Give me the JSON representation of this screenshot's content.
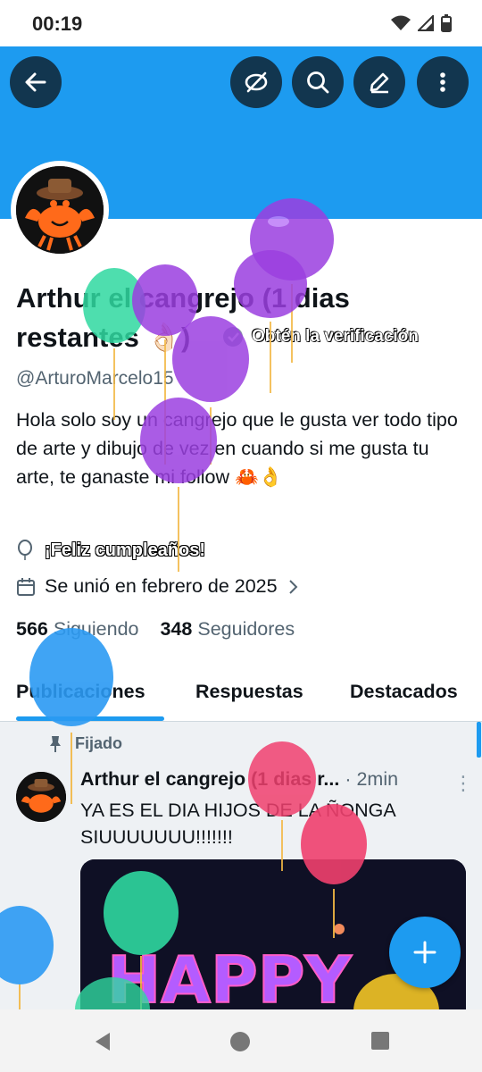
{
  "status_bar": {
    "time": "00:19"
  },
  "profile": {
    "name": "Arthur el cangrejo (1 dias restantes 👌🏻)",
    "verify_cta": "Obtén la verificación",
    "handle": "@ArturoMarcelo15",
    "bio": "Hola solo soy un cangrejo que le gusta ver todo tipo de arte y dibujo de vez en cuando si me gusta tu arte, te ganaste mi follow 🦀👌",
    "birthday": "¡Feliz cumpleaños!",
    "joined": "Se unió en febrero de 2025",
    "following_count": "566",
    "following_label": "Siguiendo",
    "followers_count": "348",
    "followers_label": "Seguidores"
  },
  "tabs": [
    {
      "label": "Publicaciones",
      "active": true
    },
    {
      "label": "Respuestas",
      "active": false
    },
    {
      "label": "Destacados",
      "active": false
    }
  ],
  "post": {
    "pinned_label": "Fijado",
    "author": "Arthur el cangrejo (1 dias r...",
    "meta": " · 2min",
    "text": "YA ES EL DIA HIJOS DE LA ÑONGA SIUUUUUUU!!!!!!!",
    "media_text": "HAPPY"
  },
  "colors": {
    "accent": "#1d9bf0",
    "balloon_purple": "#9b3fe0",
    "balloon_green": "#2fd8a0",
    "balloon_blue": "#2b9af3",
    "balloon_red": "#f0406e",
    "balloon_yellow": "#f3c526"
  },
  "icons": {
    "back": "arrow-left-icon",
    "eye_off": "eye-slash-icon",
    "search": "search-icon",
    "edit": "pencil-icon",
    "more": "more-vertical-icon",
    "birthday": "balloon-icon",
    "calendar": "calendar-icon",
    "pin": "pin-icon",
    "compose": "plus-icon"
  }
}
